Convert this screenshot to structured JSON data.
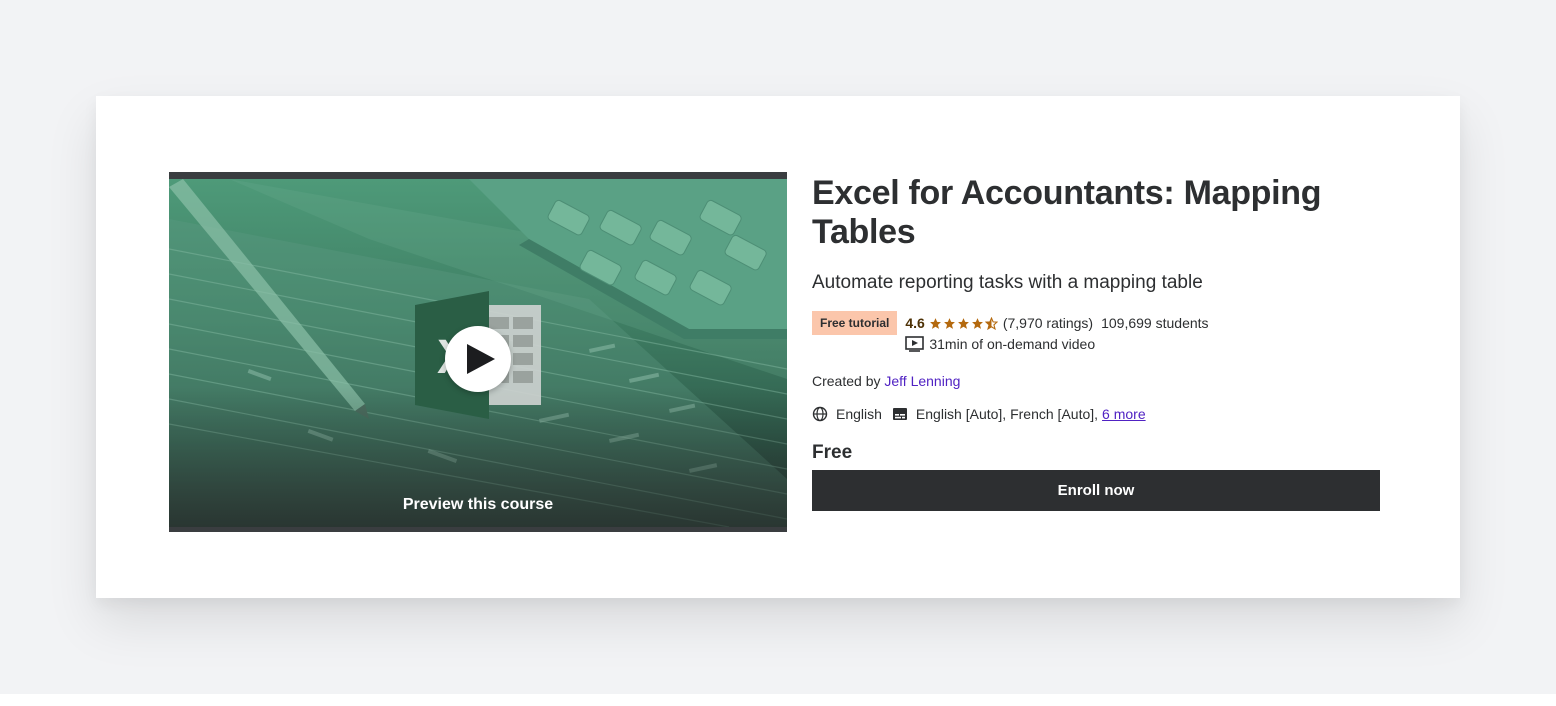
{
  "course": {
    "title": "Excel for Accountants: Mapping Tables",
    "subtitle": "Automate reporting tasks with a mapping table",
    "badge": "Free tutorial",
    "rating": "4.6",
    "rating_value": 4.6,
    "ratings_count": "(7,970 ratings)",
    "students": "109,699 students",
    "video_length": "31min of on-demand video",
    "created_by_label": "Created by",
    "instructor": "Jeff Lenning",
    "language": "English",
    "captions": "English [Auto], French [Auto],",
    "more_captions": "6 more",
    "price": "Free",
    "enroll_label": "Enroll now"
  },
  "preview": {
    "label": "Preview this course"
  },
  "icons": {
    "play": "play-icon",
    "star": "star-icon",
    "video": "video-icon",
    "globe": "globe-icon",
    "captions": "captions-icon",
    "excel": "excel-logo-icon"
  },
  "colors": {
    "page_bg": "#f2f3f5",
    "badge_bg": "#fbc6ab",
    "star": "#b4690e",
    "link": "#5022c3",
    "button_bg": "#2d2f31",
    "text": "#2d2f31"
  }
}
